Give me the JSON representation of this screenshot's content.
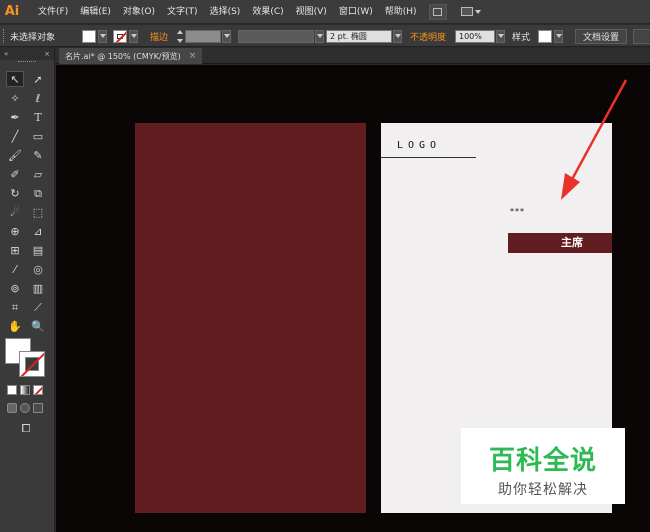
{
  "app": {
    "logo": "Ai"
  },
  "menu": {
    "items": [
      "文件(F)",
      "编辑(E)",
      "对象(O)",
      "文字(T)",
      "选择(S)",
      "效果(C)",
      "视图(V)",
      "窗口(W)",
      "帮助(H)"
    ]
  },
  "control_bar": {
    "selection_label": "未选择对象",
    "stroke_label": "描边",
    "brush_field": "2 pt. 椭圆",
    "opacity_label": "不透明度",
    "opacity_value": "100%",
    "style_label": "样式",
    "doc_settings_button": "文档设置"
  },
  "document": {
    "tab_title": "名片.ai* @ 150% (CMYK/预览)",
    "close_glyph": "×"
  },
  "artwork": {
    "logo_text": "LOGO",
    "name_placeholder": "***",
    "title_text": "主席",
    "card_color": "#611d1f",
    "back_color": "#f2eff0"
  },
  "annotation": {
    "arrow_color": "#e8322a"
  },
  "watermark": {
    "main": "百科全说",
    "sub": "助你轻松解决",
    "color": "#2dba54"
  },
  "colors": {
    "accent": "#f7931e",
    "ui_background": "#3a3a3a",
    "canvas": "#0b0606"
  }
}
